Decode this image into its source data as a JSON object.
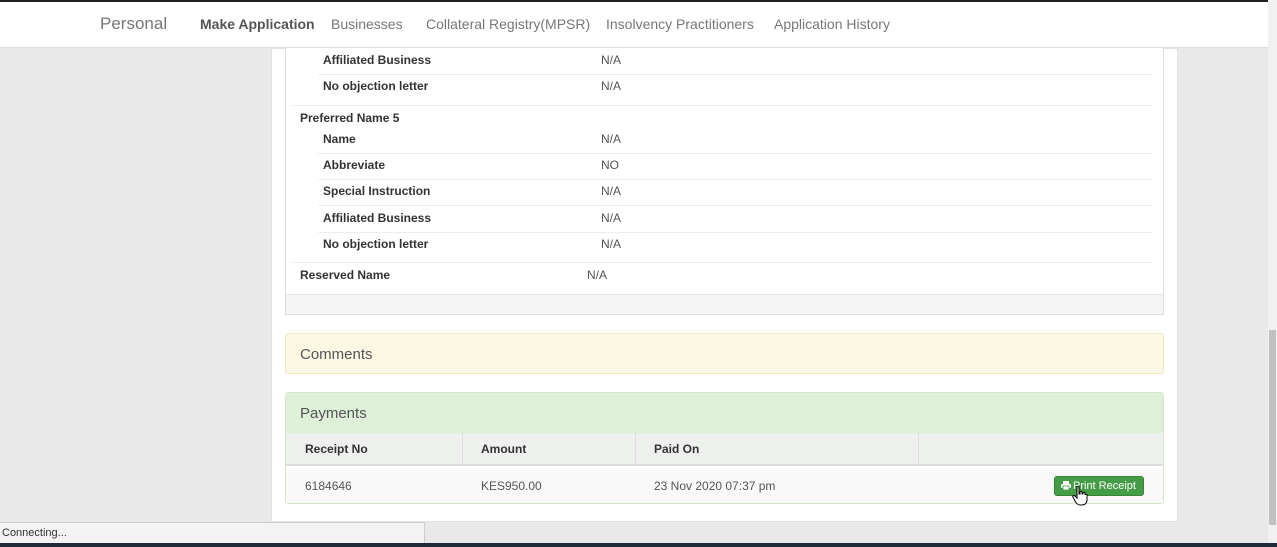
{
  "nav": {
    "brand": "Personal",
    "items": [
      "Make Application",
      "Businesses",
      "Collateral Registry(MPSR)",
      "Insolvency Practitioners",
      "Application History"
    ]
  },
  "details": {
    "prev_affiliated_label": "Affiliated Business",
    "prev_affiliated_value": "N/A",
    "prev_noobjection_label": "No objection letter",
    "prev_noobjection_value": "N/A",
    "section_title": "Preferred Name 5",
    "rows": [
      {
        "label": "Name",
        "value": "N/A"
      },
      {
        "label": "Abbreviate",
        "value": "NO"
      },
      {
        "label": "Special Instruction",
        "value": "N/A"
      },
      {
        "label": "Affiliated Business",
        "value": "N/A"
      },
      {
        "label": "No objection letter",
        "value": "N/A"
      }
    ],
    "reserved_label": "Reserved Name",
    "reserved_value": "N/A"
  },
  "comments": {
    "title": "Comments"
  },
  "payments": {
    "title": "Payments",
    "columns": [
      "Receipt No",
      "Amount",
      "Paid On"
    ],
    "row": {
      "receipt_no": "6184646",
      "amount": "KES950.00",
      "paid_on": "23 Nov 2020 07:37 pm"
    },
    "print_label": "Print Receipt"
  },
  "status": {
    "text": "Connecting..."
  },
  "icons": {
    "print": "print-icon",
    "cursor": "hand-pointer-icon"
  },
  "colors": {
    "success": "#449d44",
    "panel_success": "#dff0d8",
    "panel_warning": "#fcf8e3"
  }
}
